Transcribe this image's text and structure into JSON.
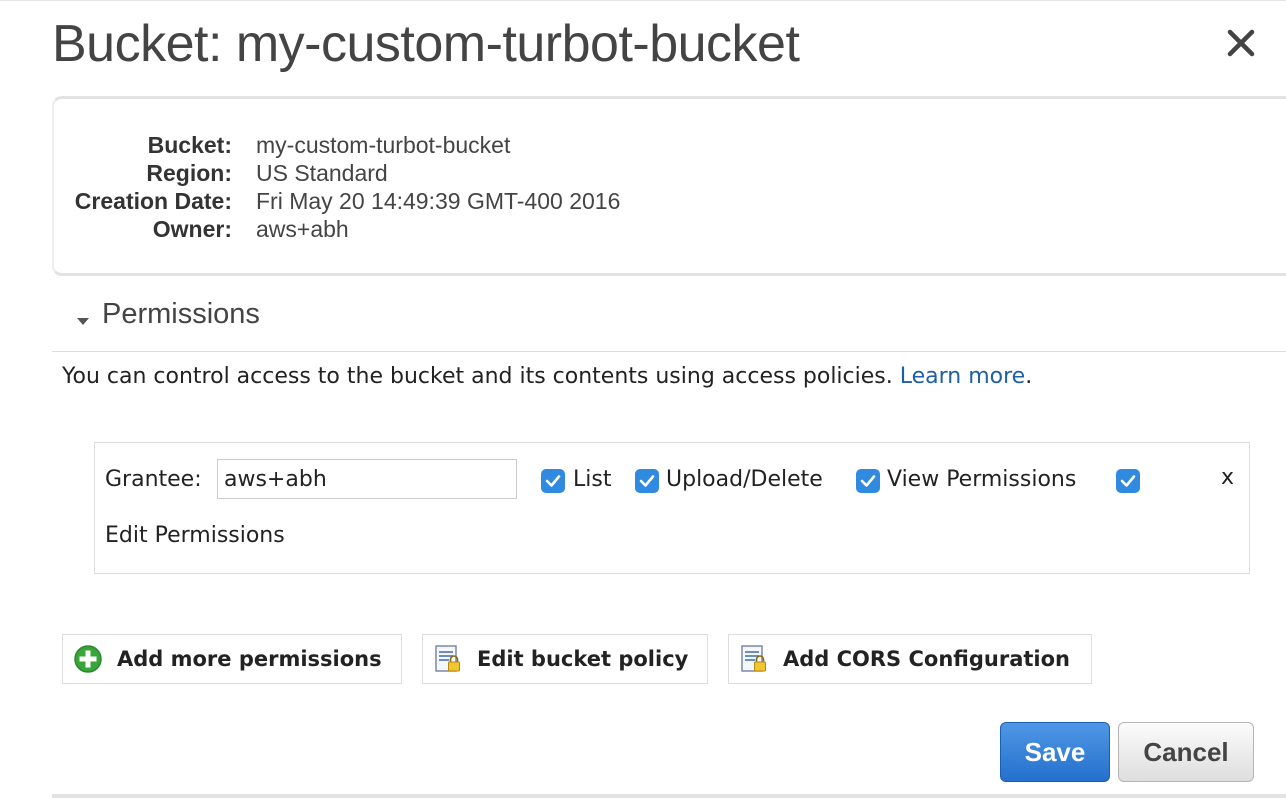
{
  "dialog": {
    "title": "Bucket: my-custom-turbot-bucket"
  },
  "bucket_info": {
    "rows": [
      {
        "label": "Bucket:",
        "value": "my-custom-turbot-bucket"
      },
      {
        "label": "Region:",
        "value": "US Standard"
      },
      {
        "label": "Creation Date:",
        "value": "Fri May 20 14:49:39 GMT-400 2016"
      },
      {
        "label": "Owner:",
        "value": "aws+abh"
      }
    ]
  },
  "permissions": {
    "section_title": "Permissions",
    "description": "You can control access to the bucket and its contents using access policies.",
    "learn_more": "Learn more",
    "period": ".",
    "grantee": {
      "label": "Grantee:",
      "value": "aws+abh",
      "list_label": "List",
      "upload_delete_label": "Upload/Delete",
      "view_permissions_label": "View Permissions",
      "edit_permissions_label": "Edit Permissions",
      "remove_label": "x",
      "checked": true
    },
    "add_more_label": "Add more permissions",
    "edit_policy_label": "Edit bucket policy",
    "add_cors_label": "Add CORS Configuration"
  },
  "footer": {
    "save_label": "Save",
    "cancel_label": "Cancel"
  },
  "colors": {
    "accent": "#2f8ae0",
    "link": "#1f5fa3",
    "add_icon": "#3aa53a"
  }
}
